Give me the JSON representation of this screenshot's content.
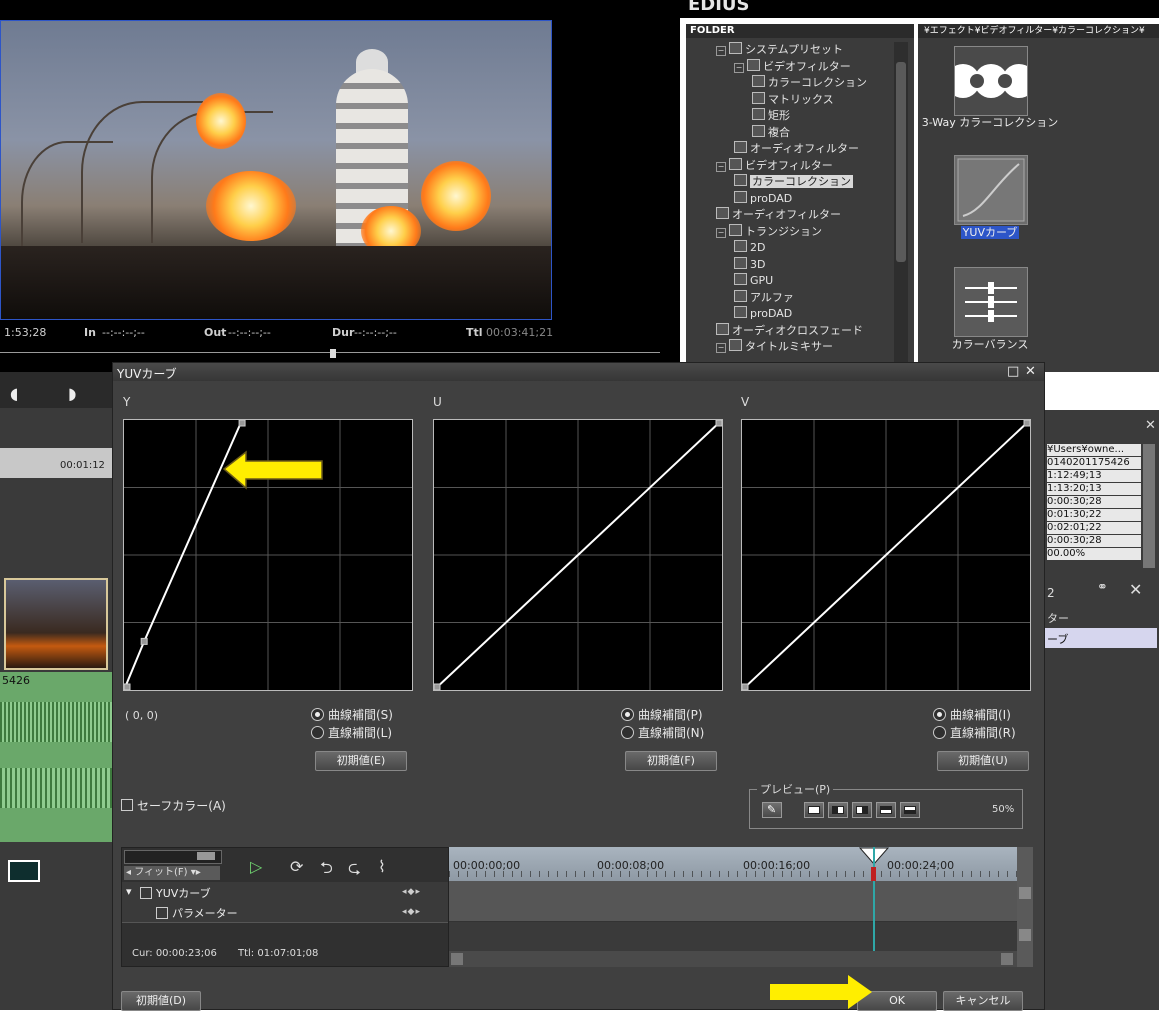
{
  "app": {
    "title_fragment": "EDIUS"
  },
  "player": {
    "timecode": "1:53;28",
    "in_label": "In",
    "in_value": "--:--:--;--",
    "out_label": "Out",
    "out_value": "--:--:--;--",
    "dur_label": "Dur",
    "dur_value": "--:--:--;--",
    "ttl_label": "Ttl",
    "ttl_value": "00:03:41;21"
  },
  "folder_panel": {
    "header": "FOLDER",
    "items": [
      {
        "label": "システムプリセット",
        "depth": 0,
        "kind": "folder"
      },
      {
        "label": "ビデオフィルター",
        "depth": 1,
        "kind": "folder"
      },
      {
        "label": "カラーコレクション",
        "depth": 2,
        "kind": "item"
      },
      {
        "label": "マトリックス",
        "depth": 2,
        "kind": "item"
      },
      {
        "label": "矩形",
        "depth": 2,
        "kind": "item"
      },
      {
        "label": "複合",
        "depth": 2,
        "kind": "item"
      },
      {
        "label": "オーディオフィルター",
        "depth": 1,
        "kind": "item"
      },
      {
        "label": "ビデオフィルター",
        "depth": 0,
        "kind": "folder"
      },
      {
        "label": "カラーコレクション",
        "depth": 1,
        "kind": "item",
        "selected": true
      },
      {
        "label": "proDAD",
        "depth": 1,
        "kind": "item"
      },
      {
        "label": "オーディオフィルター",
        "depth": 0,
        "kind": "item"
      },
      {
        "label": "トランジション",
        "depth": 0,
        "kind": "folder"
      },
      {
        "label": "2D",
        "depth": 1,
        "kind": "item"
      },
      {
        "label": "3D",
        "depth": 1,
        "kind": "item"
      },
      {
        "label": "GPU",
        "depth": 1,
        "kind": "item"
      },
      {
        "label": "アルファ",
        "depth": 1,
        "kind": "item"
      },
      {
        "label": "proDAD",
        "depth": 1,
        "kind": "item"
      },
      {
        "label": "オーディオクロスフェード",
        "depth": 0,
        "kind": "item"
      },
      {
        "label": "タイトルミキサー",
        "depth": 0,
        "kind": "folder"
      }
    ]
  },
  "effect_panel": {
    "header": "¥エフェクト¥ビデオフィルター¥カラーコレクション¥",
    "items": [
      {
        "label": "3-Way カラーコレクション",
        "icon": "three-way-icon"
      },
      {
        "label": "YUVカーブ",
        "icon": "curve-icon",
        "selected": true
      },
      {
        "label": "カラーバランス",
        "icon": "sliders-icon"
      }
    ]
  },
  "timeline_left": {
    "ruler_tc": "00:01:12",
    "clip_id": "5426"
  },
  "info_panel": {
    "rows": [
      "¥Users¥owne...",
      "0140201175426",
      "1:12:49;13",
      "1:13:20;13",
      "0:00:30;28",
      "0:01:30;22",
      "0:02:01;22",
      "0:00:30;28",
      "00.00%"
    ],
    "count": "2",
    "list": [
      "ター",
      "ーブ"
    ]
  },
  "dialog": {
    "title": "YUVカーブ",
    "channels": [
      {
        "label": "Y",
        "curve": [
          [
            0,
            0
          ],
          [
            0.07,
            0.18
          ],
          [
            0.41,
            1.0
          ]
        ],
        "radio_curve": "曲線補間(S)",
        "radio_linear": "直線補間(L)",
        "reset": "初期値(E)"
      },
      {
        "label": "U",
        "curve": [
          [
            0,
            0
          ],
          [
            1,
            1
          ]
        ],
        "radio_curve": "曲線補間(P)",
        "radio_linear": "直線補間(N)",
        "reset": "初期値(F)"
      },
      {
        "label": "V",
        "curve": [
          [
            0,
            0
          ],
          [
            1,
            1
          ]
        ],
        "radio_curve": "曲線補間(I)",
        "radio_linear": "直線補間(R)",
        "reset": "初期値(U)"
      }
    ],
    "coord": "( 0,  0)",
    "safe_color": "セーフカラー(A)",
    "preview": {
      "legend": "プレビュー(P)",
      "percent": "50%"
    },
    "timeline": {
      "fit_label": "フィット(F)",
      "ruler": [
        "00:00:00;00",
        "00:00:08;00",
        "00:00:16;00",
        "00:00:24;00"
      ],
      "tracks": [
        "YUVカーブ",
        "パラメーター"
      ],
      "cur_label": "Cur:",
      "cur_value": "00:00:23;06",
      "ttl_label": "Ttl:",
      "ttl_value": "01:07:01;08"
    },
    "reset_all": "初期値(D)",
    "ok": "OK",
    "cancel": "キャンセル"
  },
  "colors": {
    "accent_yellow": "#ffee00",
    "selection_blue": "#2d55c8",
    "playhead_cyan": "#2fa7a7"
  }
}
